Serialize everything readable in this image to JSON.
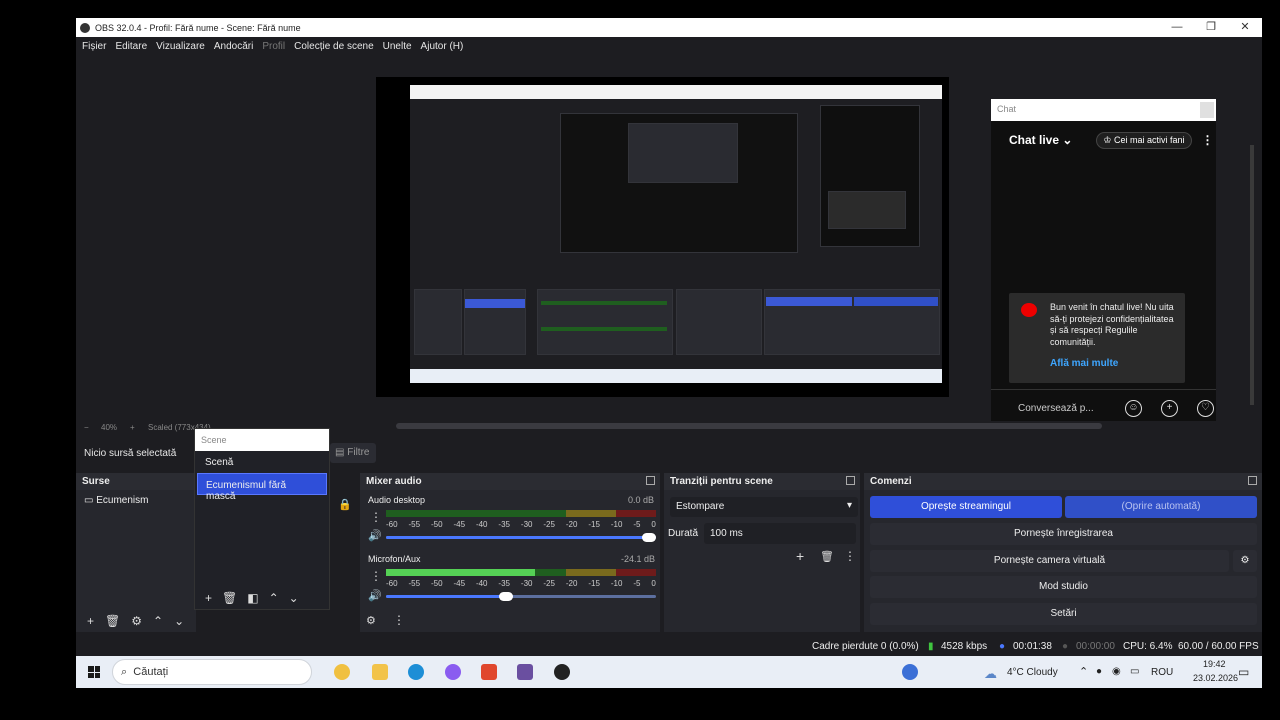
{
  "window": {
    "title": "OBS 32.0.4 - Profil: Fără nume - Scene: Fără nume",
    "controls": [
      "—",
      "❐",
      "✕"
    ]
  },
  "menu": [
    "Fișier",
    "Editare",
    "Vizualizare",
    "Andocări",
    "Profil",
    "Colecție de scene",
    "Unelte",
    "Ajutor (H)"
  ],
  "chat": {
    "placeholder": "Chat",
    "live_label": "Chat live",
    "top_fans": "Cei mai activi fani",
    "welcome": "Bun venit în chatul live! Nu uita să-ți protejezi confidențialitatea și să respecți Regulile comunității.",
    "learn_more": "Află mai multe",
    "input_placeholder": "Conversează p..."
  },
  "zoom": {
    "minus": "−",
    "percent": "40%",
    "plus": "+",
    "scaled": "Scaled (773x434)"
  },
  "sources_bar": {
    "no_source": "Nicio sursă selectată",
    "filters": "Filtre"
  },
  "scene_popup": {
    "title": "Scene",
    "items": [
      "Scenă",
      "Ecumenismul fără mască"
    ]
  },
  "sources": {
    "title": "Surse",
    "items": [
      "Ecumenism"
    ]
  },
  "mixer": {
    "title": "Mixer audio",
    "ticks": [
      "-60",
      "-55",
      "-50",
      "-45",
      "-40",
      "-35",
      "-30",
      "-25",
      "-20",
      "-15",
      "-10",
      "-5",
      "0"
    ],
    "channels": [
      {
        "name": "Audio desktop",
        "db": "0.0 dB",
        "level": 0.0,
        "volume": 1.0
      },
      {
        "name": "Microfon/Aux",
        "db": "-24.1 dB",
        "level": 0.55,
        "volume": 0.44
      }
    ]
  },
  "transitions": {
    "title": "Tranziții pentru scene",
    "selected": "Estompare",
    "duration_label": "Durată",
    "duration_value": "100 ms"
  },
  "controls": {
    "title": "Comenzi",
    "stop_stream": "Oprește streamingul",
    "auto_stop": "(Oprire automată)",
    "start_record": "Pornește înregistrarea",
    "virtual_cam": "Pornește camera virtuală",
    "studio": "Mod studio",
    "settings": "Setări"
  },
  "status": {
    "dropped": "Cadre pierdute 0 (0.0%)",
    "bitrate": "4528 kbps",
    "stream_time": "00:01:38",
    "record_time": "00:00:00",
    "cpu": "CPU: 6.4%",
    "fps": "60.00 / 60.00 FPS"
  },
  "taskbar": {
    "search": "Căutați",
    "weather": "4°C  Cloudy",
    "lang": "ROU",
    "time": "19:42",
    "date": "23.02.2026"
  }
}
